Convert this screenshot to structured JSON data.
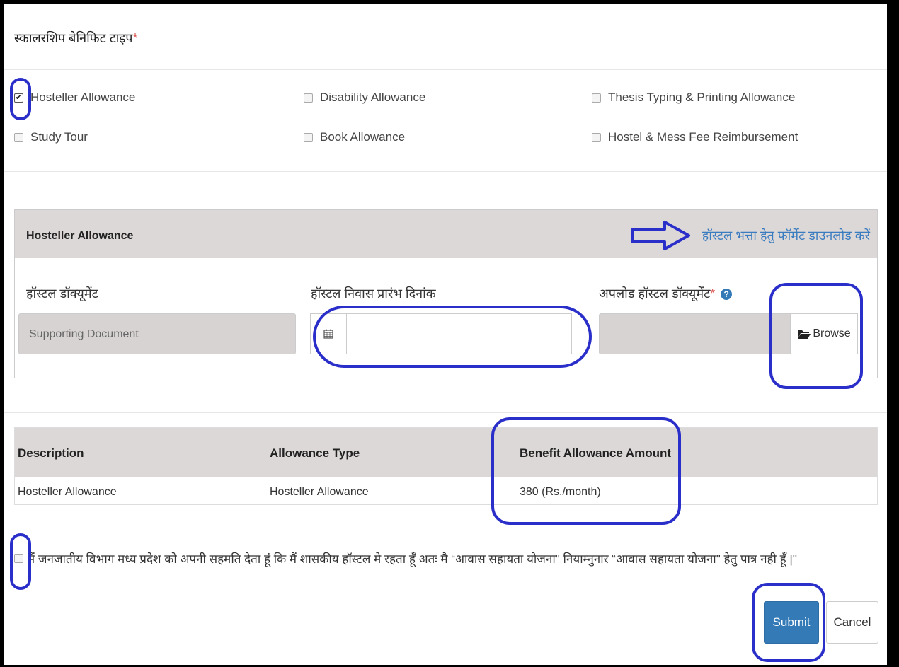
{
  "section": {
    "title": "स्कालरशिप बेनिफिट टाइप",
    "required_mark": "*"
  },
  "benefits": [
    {
      "label": "Hosteller Allowance",
      "checked": true
    },
    {
      "label": "Disability Allowance",
      "checked": false
    },
    {
      "label": "Thesis Typing & Printing Allowance",
      "checked": false
    },
    {
      "label": "Study Tour",
      "checked": false
    },
    {
      "label": "Book Allowance",
      "checked": false
    },
    {
      "label": "Hostel & Mess Fee Reimbursement",
      "checked": false
    }
  ],
  "panel": {
    "title": "Hosteller Allowance",
    "download_link": "हॉस्टल भत्ता हेतु फॉर्मेट डाउनलोड करें",
    "fields": {
      "hostel_document_label": "हॉस्टल डॉक्यूमेंट",
      "hostel_document_placeholder": "Supporting Document",
      "start_date_label": "हॉस्टल निवास प्रारंभ दिनांक",
      "start_date_value": "",
      "upload_label": "अपलोड हॉस्टल डॉक्यूमेंट",
      "upload_required": "*",
      "browse_label": "Browse"
    }
  },
  "table": {
    "headers": [
      "Description",
      "Allowance Type",
      "Benefit Allowance Amount"
    ],
    "rows": [
      [
        "Hosteller Allowance",
        "Hosteller Allowance",
        "380 (Rs./month)"
      ]
    ]
  },
  "consent": {
    "checked": false,
    "text": "मैं जनजातीय विभाग मध्य प्रदेश को अपनी सहमति देता हूं कि मैं शासकीय हॉस्टल मे रहता हूँ अतः मै “आवास सहायता योजना\" नियाम्नुनार “आवास सहायता योजना\" हेतु पात्र नही हूँ |\""
  },
  "actions": {
    "submit": "Submit",
    "cancel": "Cancel"
  },
  "icons": {
    "checkmark": "✔",
    "calendar": "📅",
    "folder": "📂",
    "help": "?"
  },
  "colors": {
    "primary": "#337ab7",
    "annotation": "#2b2fc9",
    "link": "#3a7cc0",
    "required": "#d9534f"
  }
}
